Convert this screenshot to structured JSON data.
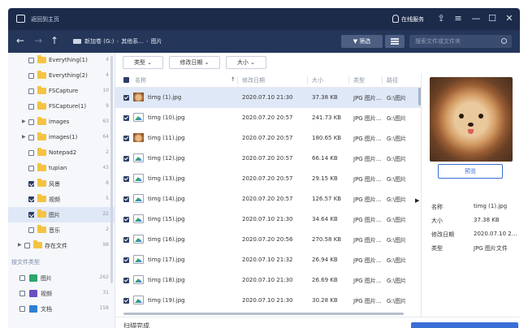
{
  "titlebar": {
    "home_label": "返回到主页",
    "service_label": "在线服务",
    "buttons": [
      "share",
      "menu",
      "minimize",
      "maximize",
      "close"
    ]
  },
  "toolbar": {
    "breadcrumb": [
      "新加卷 (G:)",
      "其他系...",
      "图片"
    ],
    "filter_label": "筛选",
    "search_placeholder": "搜索文件或文件夹"
  },
  "sidebar": {
    "items": [
      {
        "label": "Everything(1)",
        "count": "4",
        "checked": false,
        "expandable": false
      },
      {
        "label": "Everything(2)",
        "count": "4",
        "checked": false,
        "expandable": false
      },
      {
        "label": "FSCapture",
        "count": "10",
        "checked": false,
        "expandable": false
      },
      {
        "label": "FSCapture(1)",
        "count": "9",
        "checked": false,
        "expandable": false
      },
      {
        "label": "images",
        "count": "63",
        "checked": false,
        "expandable": true
      },
      {
        "label": "images(1)",
        "count": "64",
        "checked": false,
        "expandable": true
      },
      {
        "label": "Notepad2",
        "count": "2",
        "checked": false,
        "expandable": false
      },
      {
        "label": "tupian",
        "count": "43",
        "checked": false,
        "expandable": false
      },
      {
        "label": "风景",
        "count": "8",
        "checked": true,
        "expandable": false
      },
      {
        "label": "视频",
        "count": "5",
        "checked": true,
        "expandable": false
      },
      {
        "label": "图片",
        "count": "22",
        "checked": true,
        "expandable": false,
        "selected": true
      },
      {
        "label": "音乐",
        "count": "2",
        "checked": false,
        "expandable": false
      },
      {
        "label": "存在文件",
        "count": "98",
        "checked": false,
        "expandable": true
      }
    ],
    "type_section_label": "按文件类型",
    "types": [
      {
        "label": "图片",
        "count": "262",
        "icon": "image-icon"
      },
      {
        "label": "视频",
        "count": "31",
        "icon": "video-icon"
      },
      {
        "label": "文档",
        "count": "158",
        "icon": "document-icon"
      }
    ]
  },
  "sortbar": {
    "buttons": [
      "类型",
      "修改日期",
      "大小"
    ]
  },
  "table": {
    "headers": {
      "name": "名称",
      "date": "修改日期",
      "size": "大小",
      "type": "类型",
      "path": "路径"
    },
    "rows": [
      {
        "name": "timg (1).jpg",
        "date": "2020.07.10 21:30",
        "size": "37.38 KB",
        "type": "JPG 图片...",
        "path": "G:\\图片",
        "selected": true,
        "thumb": "photo"
      },
      {
        "name": "timg (10).jpg",
        "date": "2020.07.20 20:57",
        "size": "241.73 KB",
        "type": "JPG 图片...",
        "path": "G:\\图片",
        "thumb": "icon"
      },
      {
        "name": "timg (11).jpg",
        "date": "2020.07.20 20:57",
        "size": "180.65 KB",
        "type": "JPG 图片...",
        "path": "G:\\图片",
        "thumb": "photo"
      },
      {
        "name": "timg (12).jpg",
        "date": "2020.07.20 20:57",
        "size": "66.14 KB",
        "type": "JPG 图片...",
        "path": "G:\\图片",
        "thumb": "icon"
      },
      {
        "name": "timg (13).jpg",
        "date": "2020.07.20 20:57",
        "size": "29.15 KB",
        "type": "JPG 图片...",
        "path": "G:\\图片",
        "thumb": "icon"
      },
      {
        "name": "timg (14).jpg",
        "date": "2020.07.20 20:57",
        "size": "126.57 KB",
        "type": "JPG 图片...",
        "path": "G:\\图片",
        "thumb": "icon"
      },
      {
        "name": "timg (15).jpg",
        "date": "2020.07.10 21:30",
        "size": "34.64 KB",
        "type": "JPG 图片...",
        "path": "G:\\图片",
        "thumb": "icon"
      },
      {
        "name": "timg (16).jpg",
        "date": "2020.07.20 20:56",
        "size": "270.58 KB",
        "type": "JPG 图片...",
        "path": "G:\\图片",
        "thumb": "icon"
      },
      {
        "name": "timg (17).jpg",
        "date": "2020.07.10 21:32",
        "size": "26.94 KB",
        "type": "JPG 图片...",
        "path": "G:\\图片",
        "thumb": "icon"
      },
      {
        "name": "timg (18).jpg",
        "date": "2020.07.10 21:30",
        "size": "26.69 KB",
        "type": "JPG 图片...",
        "path": "G:\\图片",
        "thumb": "icon"
      },
      {
        "name": "timg (19).jpg",
        "date": "2020.07.10 21:30",
        "size": "30.28 KB",
        "type": "JPG 图片...",
        "path": "G:\\图片",
        "thumb": "icon"
      }
    ]
  },
  "preview": {
    "button_label": "预览",
    "info": [
      {
        "label": "名称",
        "value": "timg (1).jpg"
      },
      {
        "label": "大小",
        "value": "37.38 KB"
      },
      {
        "label": "修改日期",
        "value": "2020.07.10 2..."
      },
      {
        "label": "类型",
        "value": "JPG 图片文件"
      }
    ]
  },
  "status": {
    "text": "扫描完成"
  },
  "colors": {
    "titlebar": "#1c2b4a",
    "toolbar": "#24365a",
    "accent": "#3a6fd8",
    "selection": "#dfe8f7",
    "folder": "#f5c342"
  }
}
